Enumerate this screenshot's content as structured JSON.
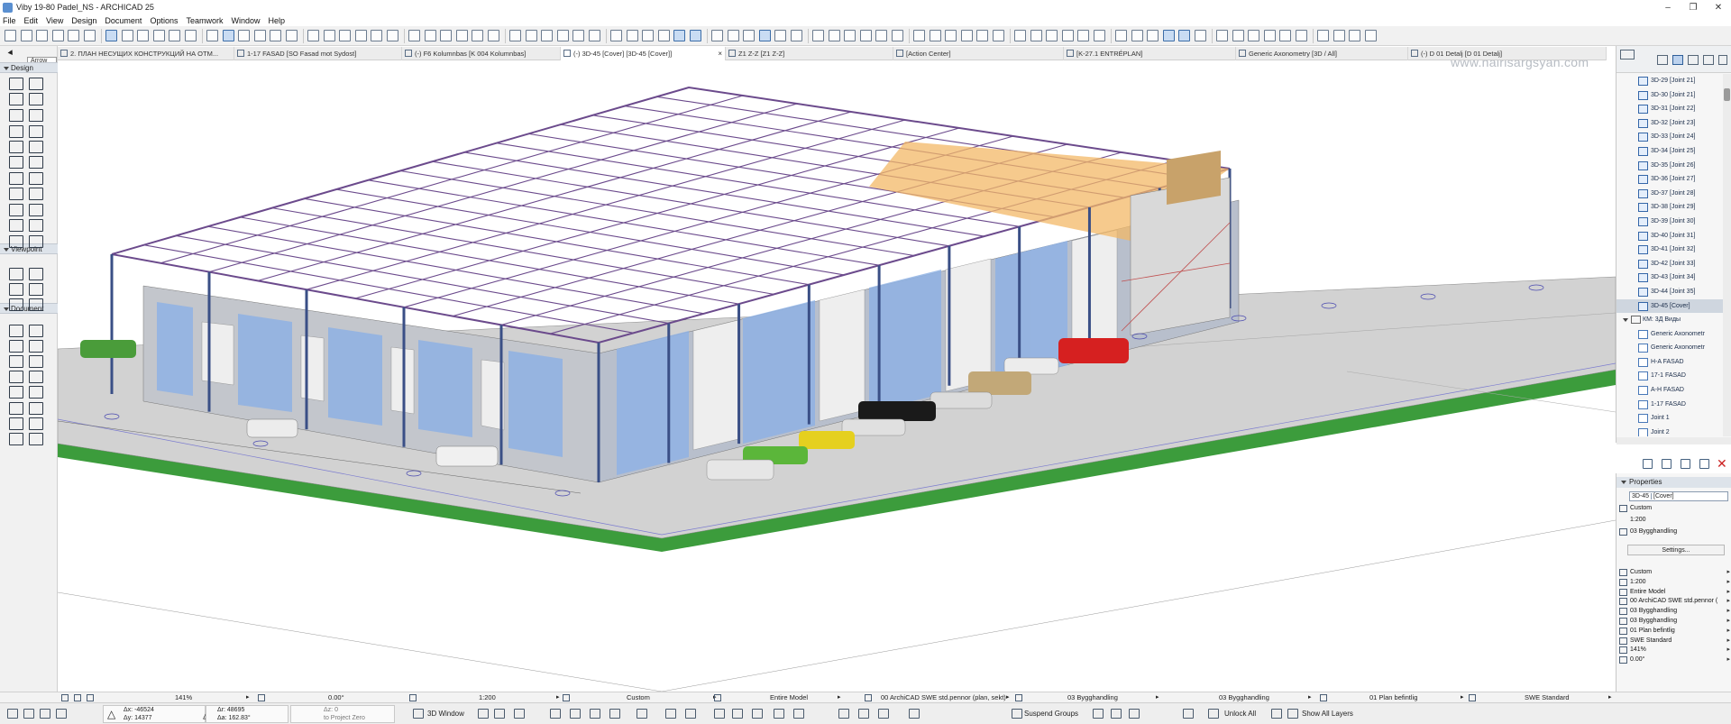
{
  "window": {
    "title": "Viby 19-80 Padel_NS - ARCHICAD 25"
  },
  "menu": [
    "File",
    "Edit",
    "View",
    "Design",
    "Document",
    "Options",
    "Teamwork",
    "Window",
    "Help"
  ],
  "tabs": [
    {
      "label": "2. ПЛАН НЕСУЩИХ КОНСТРУКЦИЙ НА ОТМ..."
    },
    {
      "label": "1-17 FASAD [SO Fasad mot Sydost]"
    },
    {
      "label": "(-) F6 Kolumnbas [K 004 Kolumnbas]"
    },
    {
      "label": "(-) 3D-45 [Cover] [3D-45 [Cover]]",
      "close": "×"
    },
    {
      "label": "Z1 Z-Z [Z1 Z-Z]"
    },
    {
      "label": "[Action Center]"
    },
    {
      "label": "[K-27.1 ENTRÉPLAN]"
    },
    {
      "label": "Generic Axonometry [3D / All]"
    },
    {
      "label": "(-) D 01 Detalj [D 01 Detalj]"
    }
  ],
  "toolbox": {
    "arrow_tool": "Arrow Tool",
    "sections": [
      "Design",
      "Viewpoint",
      "Document"
    ]
  },
  "watermark": "www.nairisargsyan.com",
  "navigator": {
    "items": [
      {
        "label": "3D-29 [Joint 21]",
        "type": "view"
      },
      {
        "label": "3D-30 [Joint 21]",
        "type": "view"
      },
      {
        "label": "3D-31 [Joint 22]",
        "type": "view"
      },
      {
        "label": "3D-32 [Joint 23]",
        "type": "view"
      },
      {
        "label": "3D-33 [Joint 24]",
        "type": "view"
      },
      {
        "label": "3D-34 [Joint 25]",
        "type": "view"
      },
      {
        "label": "3D-35 [Joint 26]",
        "type": "view"
      },
      {
        "label": "3D-36 [Joint 27]",
        "type": "view"
      },
      {
        "label": "3D-37 [Joint 28]",
        "type": "view"
      },
      {
        "label": "3D-38 [Joint 29]",
        "type": "view"
      },
      {
        "label": "3D-39 [Joint 30]",
        "type": "view"
      },
      {
        "label": "3D-40 [Joint 31]",
        "type": "view"
      },
      {
        "label": "3D-41 [Joint 32]",
        "type": "view"
      },
      {
        "label": "3D-42 [Joint 33]",
        "type": "view"
      },
      {
        "label": "3D-43 [Joint 34]",
        "type": "view"
      },
      {
        "label": "3D-44 [Joint 35]",
        "type": "view"
      },
      {
        "label": "3D-45 [Cover]",
        "type": "view",
        "selected": true
      },
      {
        "label": "КМ: 3Д Виды",
        "type": "folder"
      },
      {
        "label": "Generic Axonometr",
        "type": "sub"
      },
      {
        "label": "Generic Axonometr",
        "type": "sub"
      },
      {
        "label": "H-A FASAD",
        "type": "sub"
      },
      {
        "label": "17-1 FASAD",
        "type": "sub"
      },
      {
        "label": "A-H FASAD",
        "type": "sub"
      },
      {
        "label": "1-17 FASAD",
        "type": "sub"
      },
      {
        "label": "Joint 1",
        "type": "sub"
      },
      {
        "label": "Joint 2",
        "type": "sub"
      }
    ]
  },
  "properties": {
    "header": "Properties",
    "id_prefix": "3D-45",
    "id_name": "[Cover]",
    "rows_top": [
      "Custom",
      "1:200",
      "03 Bygghandling"
    ],
    "settings": "Settings...",
    "rows": [
      "Custom",
      "1:200",
      "Entire Model",
      "00 ArchiCAD SWE std.pennor (",
      "03 Bygghandling",
      "03 Bygghandling",
      "01 Plan befintlig",
      "SWE Standard",
      "141%",
      "0.00°"
    ]
  },
  "status": {
    "zoom": "141%",
    "angle": "0.00°",
    "scale": "1:200",
    "structure": "Custom",
    "model": "Entire Model",
    "pen": "00 ArchiCAD SWE std.pennor (plan, sekt)",
    "layer1": "03 Bygghandling",
    "layer2": "03 Bygghandling",
    "renovation": "01 Plan befintlig",
    "dim": "SWE Standard"
  },
  "bottom": {
    "dx": "Δx: -46524",
    "dy": "Δy: 14377",
    "dr": "Δr: 48695",
    "da": "Δa: 162.83°",
    "dz": "Δz: 0",
    "ref": "to Project Zero",
    "window3d": "3D Window",
    "suspend": "Suspend Groups",
    "unlock": "Unlock All",
    "layers": "Show All Layers"
  },
  "colors": {
    "steel": "#6b4a8c",
    "column": "#3a4f86",
    "glass": "#8cb1e6",
    "grass": "#3a9a3a",
    "floor": "#c9c9c9"
  }
}
